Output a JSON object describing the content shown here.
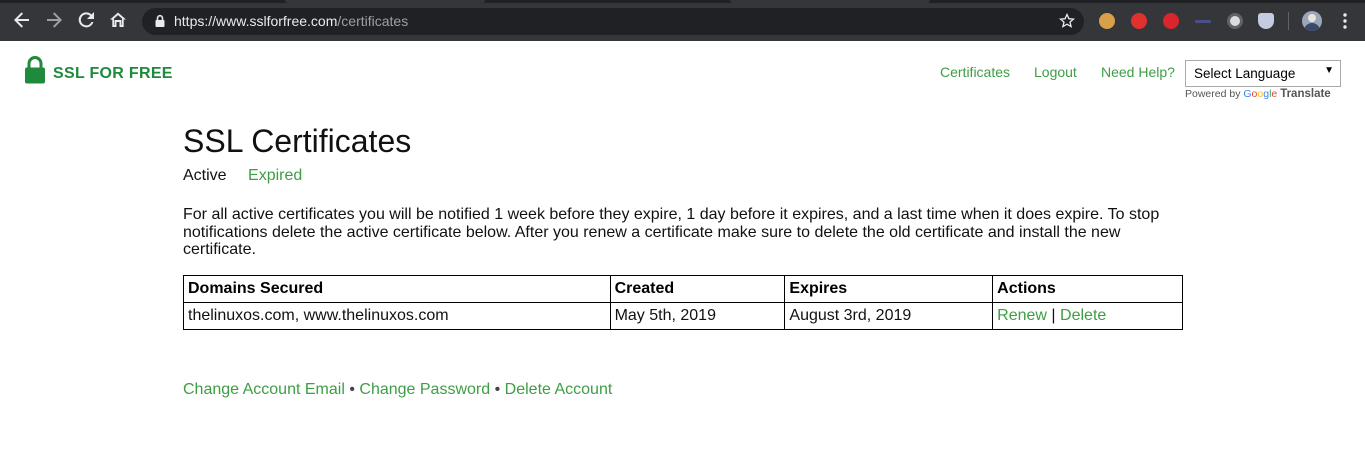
{
  "browser": {
    "url_host": "https://www.sslforfree.com",
    "url_path": "/certificates"
  },
  "header": {
    "logo_text": "SSL FOR FREE",
    "nav": {
      "certificates": "Certificates",
      "logout": "Logout",
      "help": "Need Help?"
    },
    "language": {
      "selected": "Select Language",
      "powered_by": "Powered by",
      "google": [
        "G",
        "o",
        "o",
        "g",
        "l",
        "e"
      ],
      "translate": "Translate"
    }
  },
  "main": {
    "title": "SSL Certificates",
    "tabs": {
      "active": "Active",
      "expired": "Expired"
    },
    "notice": "For all active certificates you will be notified 1 week before they expire, 1 day before it expires, and a last time when it does expire. To stop notifications delete the active certificate below. After you renew a certificate make sure to delete the old certificate and install the new certificate.",
    "table": {
      "headers": [
        "Domains Secured",
        "Created",
        "Expires",
        "Actions"
      ],
      "rows": [
        {
          "domains": "thelinuxos.com, www.thelinuxos.com",
          "created": "May 5th, 2019",
          "expires": "August 3rd, 2019",
          "renew": "Renew",
          "separator": "|",
          "delete": "Delete"
        }
      ]
    },
    "account": {
      "change_email": "Change Account Email",
      "change_password": "Change Password",
      "delete_account": "Delete Account",
      "bullet": "•"
    }
  },
  "colors": {
    "brand_green": "#1f8a3c",
    "link_green": "#3d9e44",
    "chrome_dark": "#35363a"
  },
  "icons": {
    "back": "arrow-left-icon",
    "forward": "arrow-right-icon",
    "reload": "reload-icon",
    "home": "home-icon",
    "lock": "lock-icon",
    "bookmark": "star-icon",
    "menu": "kebab-menu-icon",
    "logo": "padlock-icon"
  }
}
